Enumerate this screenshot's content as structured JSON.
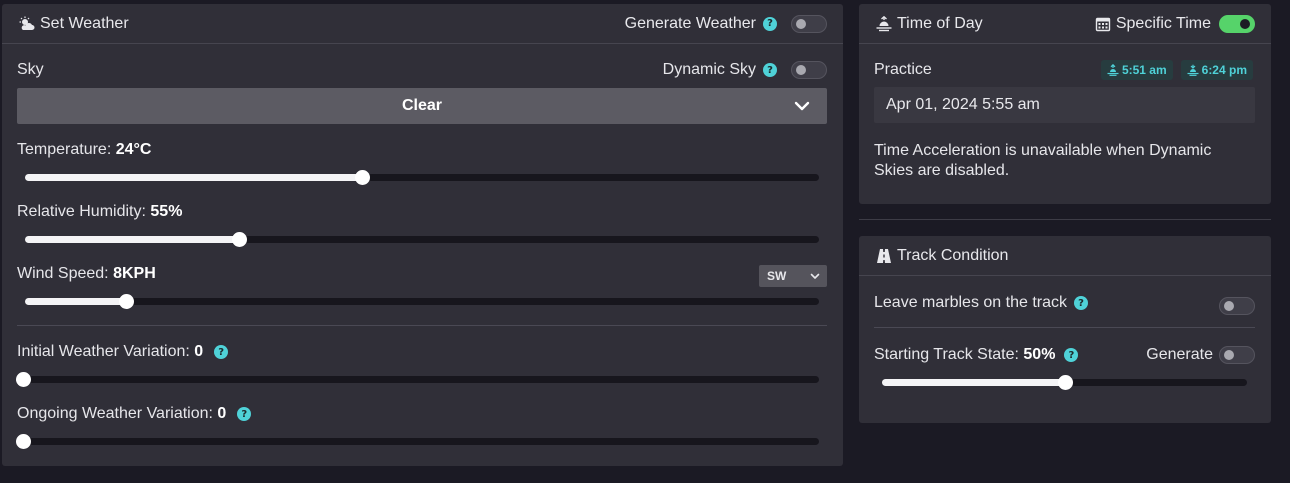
{
  "weather": {
    "title": "Set Weather",
    "generate_label": "Generate Weather",
    "generate_on": false,
    "sky_label": "Sky",
    "dynamic_sky_label": "Dynamic Sky",
    "dynamic_sky_on": false,
    "sky_value": "Clear",
    "temperature": {
      "label": "Temperature:",
      "value": "24°C",
      "fraction": 0.425
    },
    "humidity": {
      "label": "Relative Humidity:",
      "value": "55%",
      "fraction": 0.27
    },
    "wind": {
      "label": "Wind Speed:",
      "value": "8KPH",
      "fraction": 0.127,
      "direction": "SW"
    },
    "initial_variation": {
      "label": "Initial Weather Variation:",
      "value": "0",
      "fraction": 0
    },
    "ongoing_variation": {
      "label": "Ongoing Weather Variation:",
      "value": "0",
      "fraction": 0
    }
  },
  "time_of_day": {
    "title": "Time of Day",
    "specific_time_label": "Specific Time",
    "specific_time_on": true,
    "session": "Practice",
    "sunrise": "5:51 am",
    "sunset": "6:24 pm",
    "date": "Apr 01, 2024 5:55 am",
    "note": "Time Acceleration is unavailable when Dynamic Skies are disabled."
  },
  "track": {
    "title": "Track Condition",
    "marbles_label": "Leave marbles on the track",
    "marbles_on": false,
    "state_label": "Starting Track State:",
    "state_value": "50%",
    "state_fraction": 0.5,
    "generate_label": "Generate",
    "generate_on": false
  },
  "colors": {
    "accent": "#4fd2d8",
    "toggle_on": "#56d36a",
    "panel": "#302f38",
    "background": "#1b1a24"
  }
}
